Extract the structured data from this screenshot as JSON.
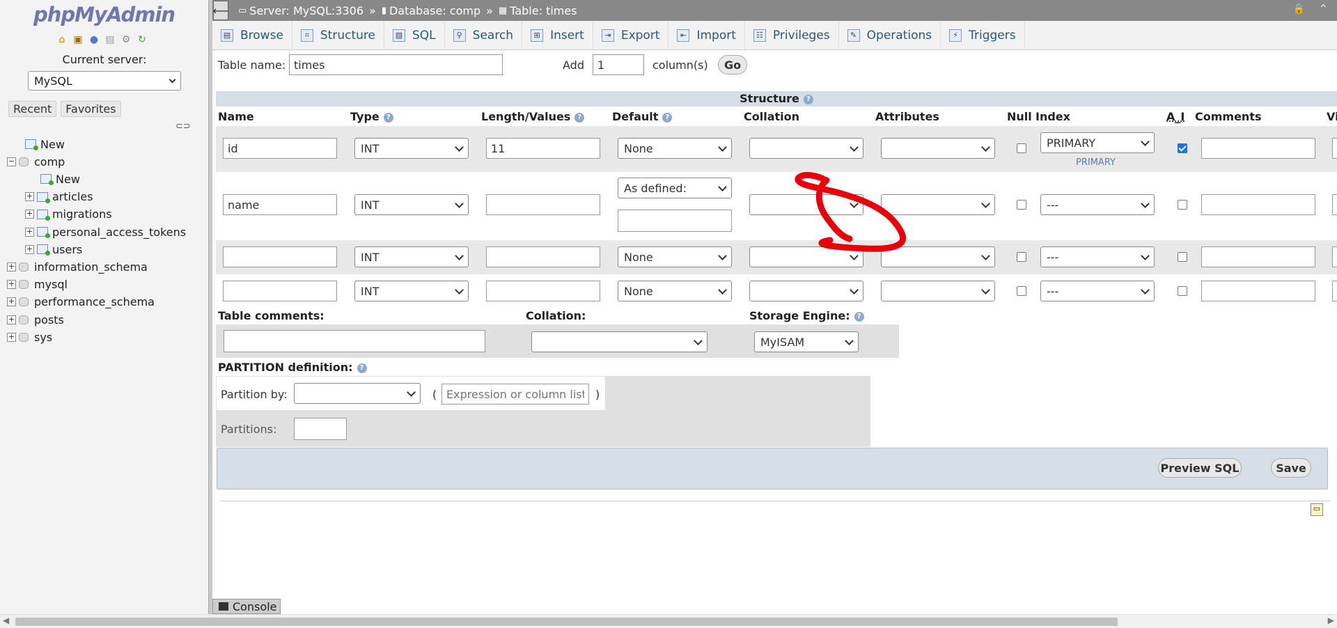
{
  "app": {
    "logo_a": "php",
    "logo_b": "MyAdmin"
  },
  "left": {
    "current_server_label": "Current server:",
    "server_select": "MySQL",
    "tabs": [
      "Recent",
      "Favorites"
    ],
    "tree": [
      {
        "label": "New",
        "level": 1,
        "type": "new"
      },
      {
        "label": "comp",
        "level": 0,
        "type": "db",
        "expanded": true
      },
      {
        "label": "New",
        "level": 2,
        "type": "new"
      },
      {
        "label": "articles",
        "level": 2,
        "type": "table"
      },
      {
        "label": "migrations",
        "level": 2,
        "type": "table"
      },
      {
        "label": "personal_access_tokens",
        "level": 2,
        "type": "table"
      },
      {
        "label": "users",
        "level": 2,
        "type": "table"
      },
      {
        "label": "information_schema",
        "level": 0,
        "type": "db"
      },
      {
        "label": "mysql",
        "level": 0,
        "type": "db"
      },
      {
        "label": "performance_schema",
        "level": 0,
        "type": "db"
      },
      {
        "label": "posts",
        "level": 0,
        "type": "db"
      },
      {
        "label": "sys",
        "level": 0,
        "type": "db"
      }
    ]
  },
  "breadcrumb": {
    "server": "Server: MySQL:3306",
    "sep": "»",
    "database": "Database: comp",
    "table": "Table: times"
  },
  "menu": [
    {
      "label": "Browse",
      "icon": "browse-icon"
    },
    {
      "label": "Structure",
      "icon": "structure-icon"
    },
    {
      "label": "SQL",
      "icon": "sql-icon"
    },
    {
      "label": "Search",
      "icon": "search-icon"
    },
    {
      "label": "Insert",
      "icon": "insert-icon"
    },
    {
      "label": "Export",
      "icon": "export-icon"
    },
    {
      "label": "Import",
      "icon": "import-icon"
    },
    {
      "label": "Privileges",
      "icon": "privileges-icon"
    },
    {
      "label": "Operations",
      "icon": "operations-icon"
    },
    {
      "label": "Triggers",
      "icon": "triggers-icon"
    }
  ],
  "form": {
    "table_name_label": "Table name:",
    "table_name_value": "times",
    "add_label": "Add",
    "add_value": "1",
    "columns_label": "column(s)",
    "go_label": "Go",
    "structure_title": "Structure",
    "headers": [
      "Name",
      "Type",
      "Length/Values",
      "Default",
      "Collation",
      "Attributes",
      "Null",
      "Index",
      "A_I",
      "Comments",
      "Vi"
    ],
    "rows": [
      {
        "name": "id",
        "type": "INT",
        "length": "11",
        "default": "None",
        "index": "PRIMARY",
        "index_note": "PRIMARY",
        "null": false,
        "ai": true
      },
      {
        "name": "name",
        "type": "INT",
        "length": "",
        "default": "As defined:",
        "index": "---",
        "null": false,
        "ai": false
      },
      {
        "name": "",
        "type": "INT",
        "length": "",
        "default": "None",
        "index": "---",
        "null": false,
        "ai": false
      },
      {
        "name": "",
        "type": "INT",
        "length": "",
        "default": "None",
        "index": "---",
        "null": false,
        "ai": false
      }
    ],
    "table_comments_label": "Table comments:",
    "collation_label": "Collation:",
    "storage_engine_label": "Storage Engine:",
    "storage_engine_value": "MyISAM",
    "partition_label": "PARTITION definition:",
    "partition_by_label": "Partition by:",
    "paren_open": "(",
    "paren_close": ")",
    "expression_placeholder": "Expression or column list",
    "partitions_label": "Partitions:",
    "preview_sql_label": "Preview SQL",
    "save_label": "Save"
  },
  "console_label": "Console",
  "colors": {
    "accent": "#235a81",
    "annotation": "#e8000b",
    "header_band": "#d5dde6"
  }
}
